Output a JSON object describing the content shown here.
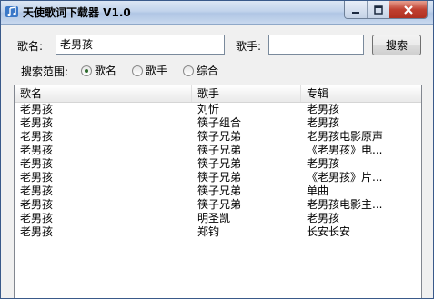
{
  "window": {
    "title": "天使歌词下载器 V1.0"
  },
  "form": {
    "song_label": "歌名:",
    "song_value": "老男孩",
    "singer_label": "歌手:",
    "singer_value": "",
    "search_button": "搜索"
  },
  "scope": {
    "label": "搜索范围:",
    "options": [
      "歌名",
      "歌手",
      "综合"
    ],
    "selected": "歌名"
  },
  "table": {
    "columns": [
      "歌名",
      "歌手",
      "专辑"
    ],
    "rows": [
      [
        "老男孩",
        "刘忻",
        "老男孩"
      ],
      [
        "老男孩",
        "筷子组合",
        "老男孩"
      ],
      [
        "老男孩",
        "筷子兄弟",
        "老男孩电影原声"
      ],
      [
        "老男孩",
        "筷子兄弟",
        "《老男孩》电..."
      ],
      [
        "老男孩",
        "筷子兄弟",
        "老男孩"
      ],
      [
        "老男孩",
        "筷子兄弟",
        "《老男孩》片..."
      ],
      [
        "老男孩",
        "筷子兄弟",
        "单曲"
      ],
      [
        "老男孩",
        "筷子兄弟",
        "老男孩电影主..."
      ],
      [
        "老男孩",
        "明圣凯",
        "老男孩"
      ],
      [
        "老男孩",
        "郑钧",
        "长安长安"
      ]
    ]
  },
  "colors": {
    "title_bar": "#c2d4ec",
    "close_button": "#c04030",
    "window_bg": "#f0f0f0"
  }
}
